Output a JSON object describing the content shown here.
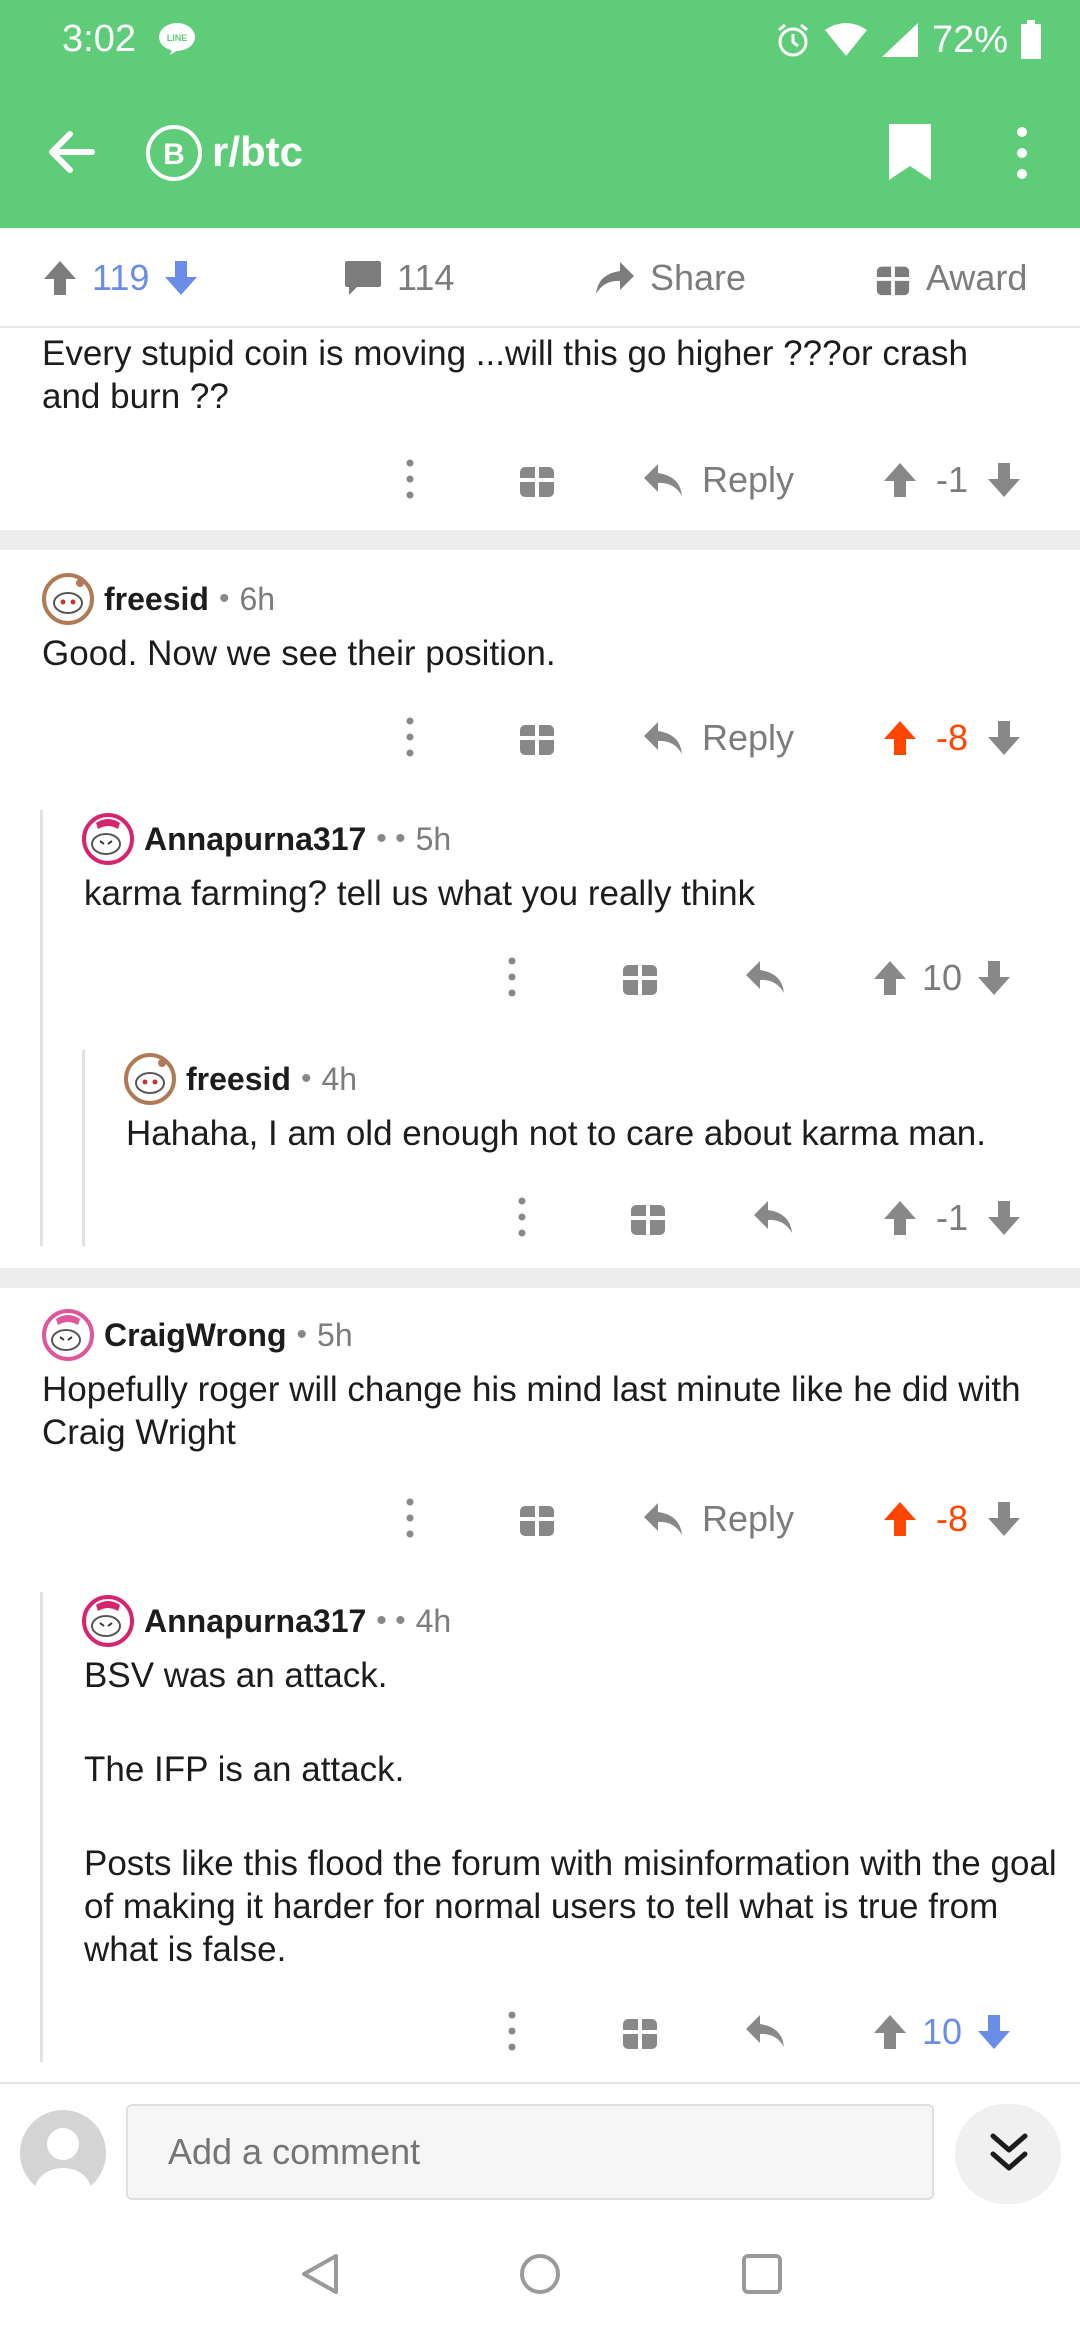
{
  "colors": {
    "accent": "#5fcc7a",
    "upvote_active": "#ff4500",
    "blue": "#6a8de8",
    "grey": "#7c7c7c"
  },
  "status": {
    "time": "3:02",
    "battery": "72%",
    "icons": [
      "line-icon",
      "alarm-icon",
      "wifi-icon",
      "signal-icon",
      "battery-icon"
    ]
  },
  "appbar": {
    "subreddit": "r/btc",
    "icons": [
      "back-arrow-icon",
      "bitcoin-icon",
      "bookmark-icon",
      "more-vert-icon"
    ]
  },
  "post_bar": {
    "upvotes": "119",
    "comments": "114",
    "share_label": "Share",
    "award_label": "Award"
  },
  "comments": [
    {
      "text": "Every stupid coin is moving ...will this go higher ???or crash and burn ??",
      "reply_label": "Reply",
      "score": "-1"
    },
    {
      "user": "freesid",
      "age": "6h",
      "text": "Good. Now we see their position.",
      "reply_label": "Reply",
      "score": "-8",
      "voted": "up"
    },
    {
      "user": "Annapurna317",
      "age": "5h",
      "text": "karma farming? tell us what you really think",
      "score": "10"
    },
    {
      "user": "freesid",
      "age": "4h",
      "text": "Hahaha, I am old enough not to care about karma man.",
      "score": "-1"
    },
    {
      "user": "CraigWrong",
      "age": "5h",
      "text": "Hopefully roger will change his mind last minute like he did with Craig Wright",
      "reply_label": "Reply",
      "score": "-8",
      "voted": "up"
    },
    {
      "user": "Annapurna317",
      "age": "4h",
      "text_p1": "BSV was an attack.",
      "text_p2": "The IFP is an attack.",
      "text_p3": "Posts like this flood the forum with misinformation with the goal of making it harder for normal users to tell what is true from what is false.",
      "score": "10",
      "voted": "down"
    }
  ],
  "compose": {
    "placeholder": "Add a comment"
  },
  "navbar": {
    "icons": [
      "back-nav-icon",
      "home-nav-icon",
      "recents-nav-icon"
    ]
  }
}
